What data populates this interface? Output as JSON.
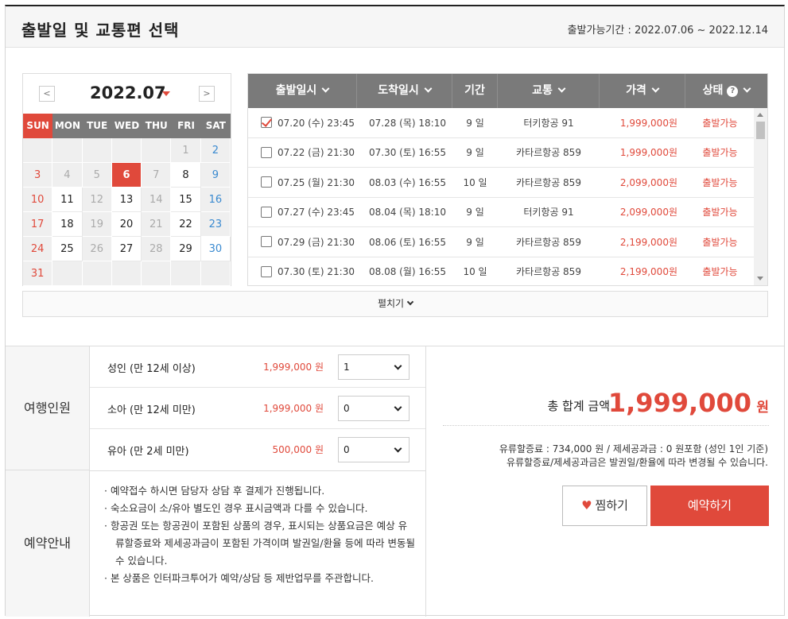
{
  "header": {
    "title": "출발일 및 교통편 선택",
    "period_label": "출발가능기간 : 2022.07.06 ~ 2022.12.14"
  },
  "calendar": {
    "month": "2022.07",
    "prev": "<",
    "next": ">",
    "dow": [
      "SUN",
      "MON",
      "TUE",
      "WED",
      "THU",
      "FRI",
      "SAT"
    ],
    "days": [
      "",
      "",
      "",
      "",
      "",
      "1",
      "2",
      "3",
      "4",
      "5",
      "6",
      "7",
      "8",
      "9",
      "10",
      "11",
      "12",
      "13",
      "14",
      "15",
      "16",
      "17",
      "18",
      "19",
      "20",
      "21",
      "22",
      "23",
      "24",
      "25",
      "26",
      "27",
      "28",
      "29",
      "30",
      "31",
      "",
      "",
      "",
      "",
      "",
      ""
    ],
    "selected": "6",
    "available": [
      "8",
      "11",
      "13",
      "15",
      "18",
      "20",
      "22",
      "25",
      "27",
      "29",
      "30"
    ]
  },
  "table": {
    "headers": [
      "출발일시",
      "도착일시",
      "기간",
      "교통",
      "가격",
      "상태"
    ],
    "rows": [
      {
        "dep": "07.20 (수) 23:45",
        "arr": "07.28 (목) 18:10",
        "dur": "9 일",
        "trans": "터키항공 91",
        "price": "1,999,000원",
        "status": "출발가능",
        "checked": true
      },
      {
        "dep": "07.22 (금) 21:30",
        "arr": "07.30 (토) 16:55",
        "dur": "9 일",
        "trans": "카타르항공 859",
        "price": "1,999,000원",
        "status": "출발가능",
        "checked": false
      },
      {
        "dep": "07.25 (월) 21:30",
        "arr": "08.03 (수) 16:55",
        "dur": "10 일",
        "trans": "카타르항공 859",
        "price": "2,099,000원",
        "status": "출발가능",
        "checked": false
      },
      {
        "dep": "07.27 (수) 23:45",
        "arr": "08.04 (목) 18:10",
        "dur": "9 일",
        "trans": "터키항공 91",
        "price": "2,099,000원",
        "status": "출발가능",
        "checked": false
      },
      {
        "dep": "07.29 (금) 21:30",
        "arr": "08.06 (토) 16:55",
        "dur": "9 일",
        "trans": "카타르항공 859",
        "price": "2,199,000원",
        "status": "출발가능",
        "checked": false
      },
      {
        "dep": "07.30 (토) 21:30",
        "arr": "08.08 (월) 16:55",
        "dur": "10 일",
        "trans": "카타르항공 859",
        "price": "2,199,000원",
        "status": "출발가능",
        "checked": false
      }
    ],
    "expand_label": "펼치기"
  },
  "travelers": {
    "label": "여행인원",
    "rows": [
      {
        "name": "성인 (만 12세 이상)",
        "price": "1,999,000 원",
        "count": "1"
      },
      {
        "name": "소아 (만 12세 미만)",
        "price": "1,999,000 원",
        "count": "0"
      },
      {
        "name": "유아 (만 2세 미만)",
        "price": "500,000 원",
        "count": "0"
      }
    ]
  },
  "notice": {
    "label": "예약안내",
    "items": [
      "· 예약접수 하시면 담당자 상담 후 결제가 진행됩니다.",
      "· 숙소요금이 소/유아 별도인 경우 표시금액과 다를 수 있습니다.",
      "· 항공권 또는 항공권이 포함된 상품의 경우, 표시되는 상품요금은 예상 유류할증료와 제세공과금이 포함된 가격이며 발권일/환율 등에 따라 변동될 수 있습니다.",
      "· 본 상품은 인터파크투어가 예약/상담 등 제반업무를 주관합니다."
    ]
  },
  "summary": {
    "total_label": "총 합계 금액",
    "total_value": "1,999,000",
    "total_unit": "원",
    "fee_note": "유류할증료 : 734,000 원 / 제세공과금 : 0 원포함 (성인 1인 기준)",
    "fee_note2": "유류할증료/제세공과금은 발권일/환율에 따라 변경될 수 있습니다.",
    "wish_label": "찜하기",
    "book_label": "예약하기"
  },
  "colors": {
    "accent": "#e0493b",
    "header_gray": "#7a7a7a"
  }
}
